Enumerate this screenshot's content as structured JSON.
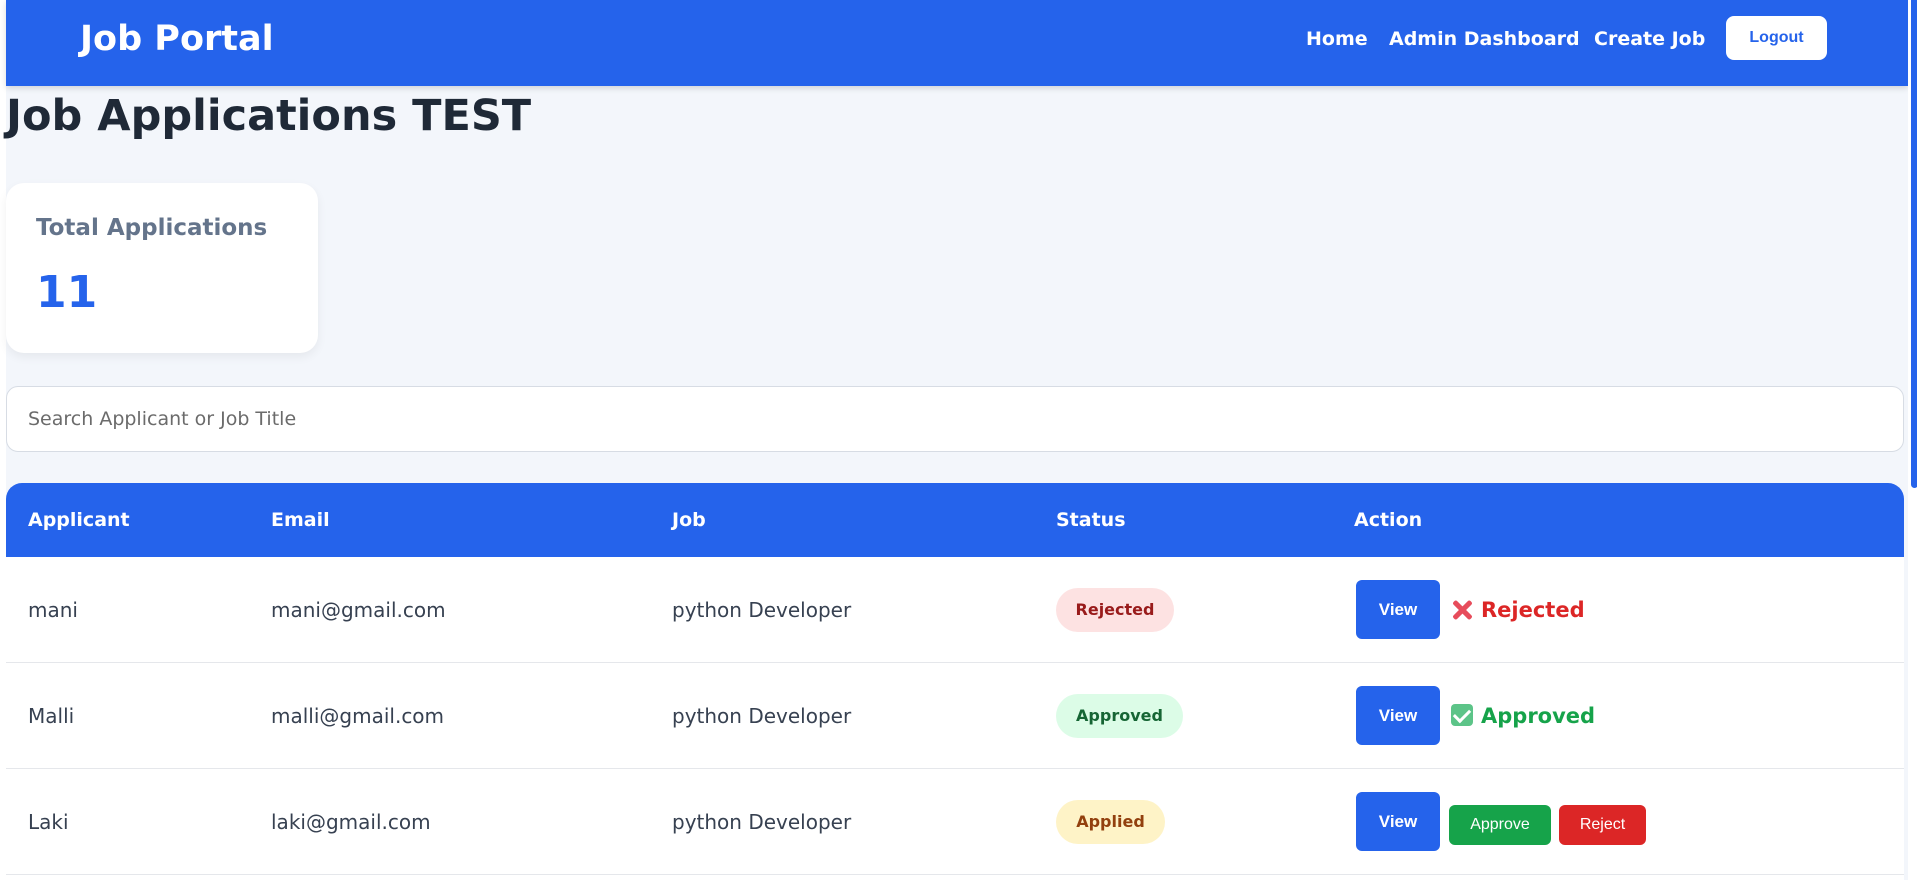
{
  "navbar": {
    "brand": "Job Portal",
    "links": [
      "Home",
      "Admin Dashboard",
      "Create Job"
    ],
    "logout_label": "Logout"
  },
  "page": {
    "title": "Job Applications TEST"
  },
  "stats": {
    "label": "Total Applications",
    "value": "11"
  },
  "search": {
    "placeholder": "Search Applicant or Job Title",
    "value": ""
  },
  "table": {
    "headers": [
      "Applicant",
      "Email",
      "Job",
      "Status",
      "Action"
    ],
    "rows": [
      {
        "applicant": "mani",
        "email": "mani@gmail.com",
        "job": "python Developer",
        "status": "Rejected",
        "view_label": "View",
        "action_result": "Rejected",
        "action_icon": "cross-mark-icon"
      },
      {
        "applicant": "Malli",
        "email": "malli@gmail.com",
        "job": "python Developer",
        "status": "Approved",
        "view_label": "View",
        "action_result": "Approved",
        "action_icon": "check-mark-icon"
      },
      {
        "applicant": "Laki",
        "email": "laki@gmail.com",
        "job": "python Developer",
        "status": "Applied",
        "view_label": "View",
        "approve_label": "Approve",
        "reject_label": "Reject"
      }
    ]
  },
  "colors": {
    "primary": "#2563eb",
    "success": "#16a34a",
    "danger": "#dc2626",
    "background": "#f3f6fb"
  }
}
